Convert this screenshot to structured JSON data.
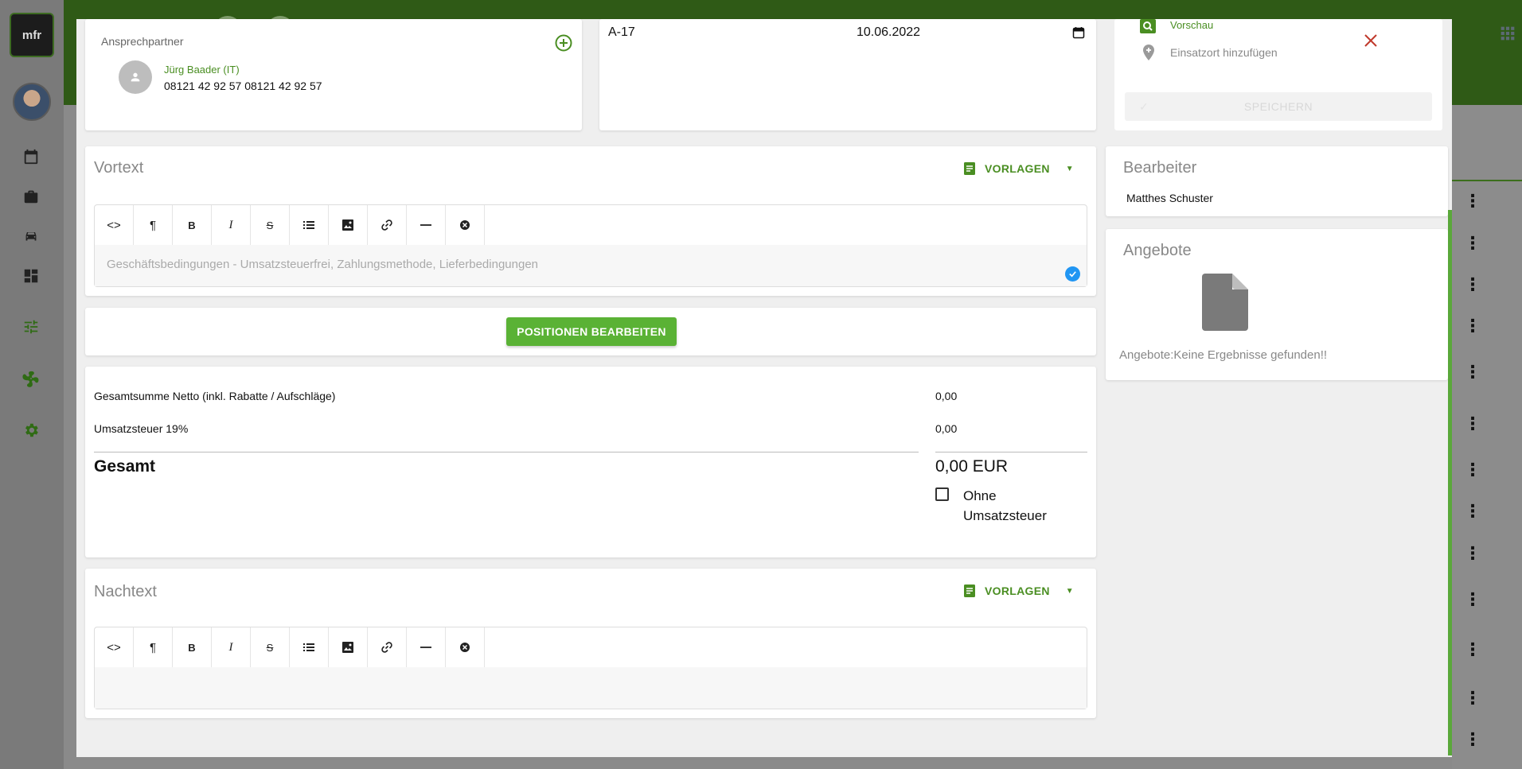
{
  "app": {
    "logo_text": "mfr"
  },
  "contact": {
    "label": "Ansprechpartner",
    "person_name": "Jürg Baader (IT)",
    "phone": "08121 42 92 57 08121 42 92 57"
  },
  "number_card": {
    "number": "A-17",
    "date": "10.06.2022"
  },
  "side_actions": {
    "preview_label": "Vorschau",
    "location_placeholder": "Einsatzort hinzufügen",
    "save_label": "SPEICHERN"
  },
  "vortext": {
    "title": "Vortext",
    "templates_label": "VORLAGEN",
    "placeholder": "Geschäftsbedingungen - Umsatzsteuerfrei, Zahlungsmethode, Lieferbedingungen"
  },
  "positions": {
    "button_label": "POSITIONEN BEARBEITEN"
  },
  "totals": {
    "net_label": "Gesamtsumme Netto (inkl. Rabatte / Aufschläge)",
    "net_value": "0,00",
    "tax_label": "Umsatzsteuer 19%",
    "tax_value": "0,00",
    "total_label": "Gesamt",
    "total_value": "0,00 EUR",
    "no_tax_label": "Ohne Umsatzsteuer",
    "no_tax_checked": false
  },
  "nachtext": {
    "title": "Nachtext",
    "templates_label": "VORLAGEN"
  },
  "bearbeiter": {
    "title": "Bearbeiter",
    "name": "Matthes Schuster"
  },
  "angebote": {
    "title": "Angebote",
    "empty_text": "Angebote:Keine Ergebnisse gefunden!!"
  },
  "toolbar_icons": [
    "code-icon",
    "paragraph-icon",
    "bold-icon",
    "italic-icon",
    "strikethrough-icon",
    "list-icon",
    "image-icon",
    "link-icon",
    "horizontal-rule-icon",
    "clear-format-icon"
  ],
  "colors": {
    "accent": "#4a8e22",
    "button": "#5ab235",
    "close": "#c0392b",
    "check": "#2196f3"
  }
}
